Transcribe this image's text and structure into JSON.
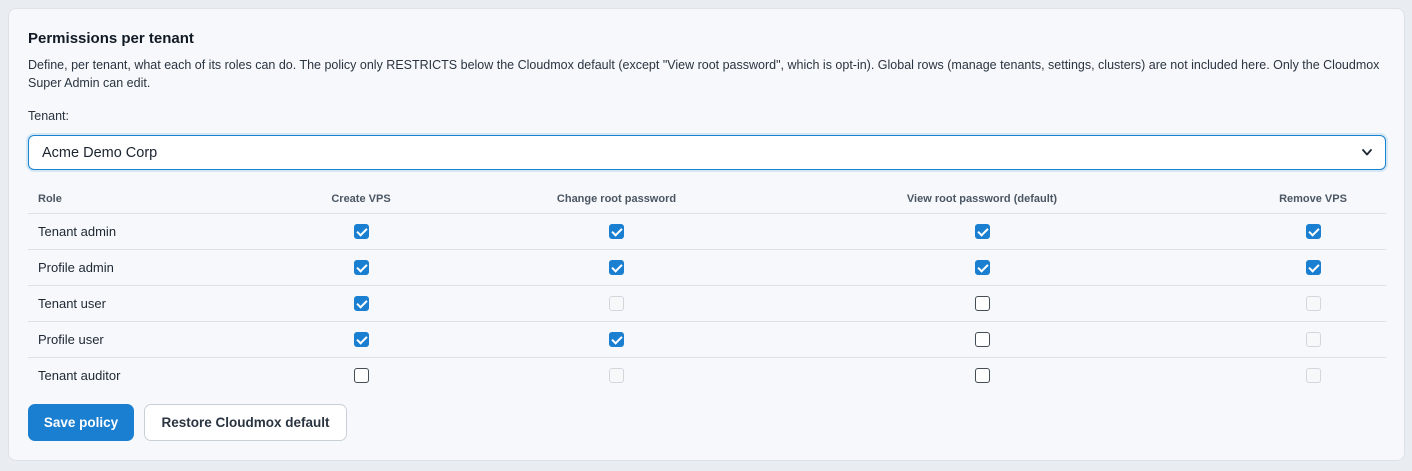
{
  "panel": {
    "title": "Permissions per tenant",
    "description": "Define, per tenant, what each of its roles can do. The policy only RESTRICTS below the Cloudmox default (except \"View root password\", which is opt-in). Global rows (manage tenants, settings, clusters) are not included here. Only the Cloudmox Super Admin can edit."
  },
  "tenant": {
    "label": "Tenant:",
    "selected": "Acme Demo Corp",
    "icon": "chevron-down-icon"
  },
  "table": {
    "headers": [
      "Role",
      "Create VPS",
      "Change root password",
      "View root password (default)",
      "Remove VPS"
    ],
    "rows": [
      {
        "role": "Tenant admin",
        "perms": [
          "checked",
          "checked",
          "checked",
          "checked"
        ]
      },
      {
        "role": "Profile admin",
        "perms": [
          "checked",
          "checked",
          "checked",
          "checked"
        ]
      },
      {
        "role": "Tenant user",
        "perms": [
          "checked",
          "disabled",
          "unchecked",
          "disabled"
        ]
      },
      {
        "role": "Profile user",
        "perms": [
          "checked",
          "checked",
          "unchecked",
          "disabled"
        ]
      },
      {
        "role": "Tenant auditor",
        "perms": [
          "unchecked",
          "disabled",
          "unchecked",
          "disabled"
        ]
      }
    ]
  },
  "actions": {
    "save_label": "Save policy",
    "restore_label": "Restore Cloudmox default"
  },
  "colors": {
    "accent": "#1a7fd0",
    "background": "#f6f8fb"
  }
}
